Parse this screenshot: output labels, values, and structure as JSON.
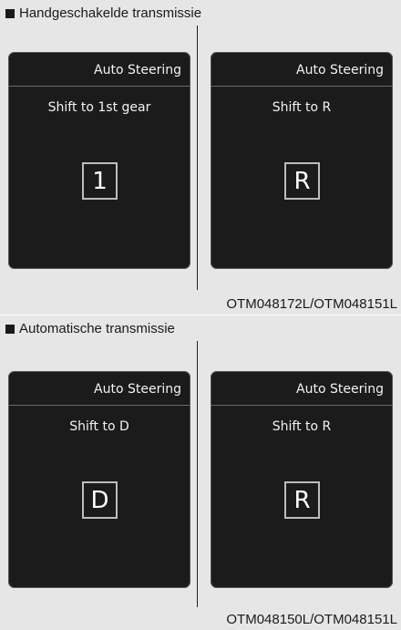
{
  "sections": [
    {
      "title": "Handgeschakelde transmissie",
      "code": "OTM048172L/OTM048151L",
      "screens": [
        {
          "header": "Auto Steering",
          "message": "Shift to 1st gear",
          "gear": "1"
        },
        {
          "header": "Auto Steering",
          "message": "Shift to R",
          "gear": "R"
        }
      ]
    },
    {
      "title": "Automatische transmissie",
      "code": "OTM048150L/OTM048151L",
      "screens": [
        {
          "header": "Auto Steering",
          "message": "Shift to D",
          "gear": "D"
        },
        {
          "header": "Auto Steering",
          "message": "Shift to R",
          "gear": "R"
        }
      ]
    }
  ]
}
